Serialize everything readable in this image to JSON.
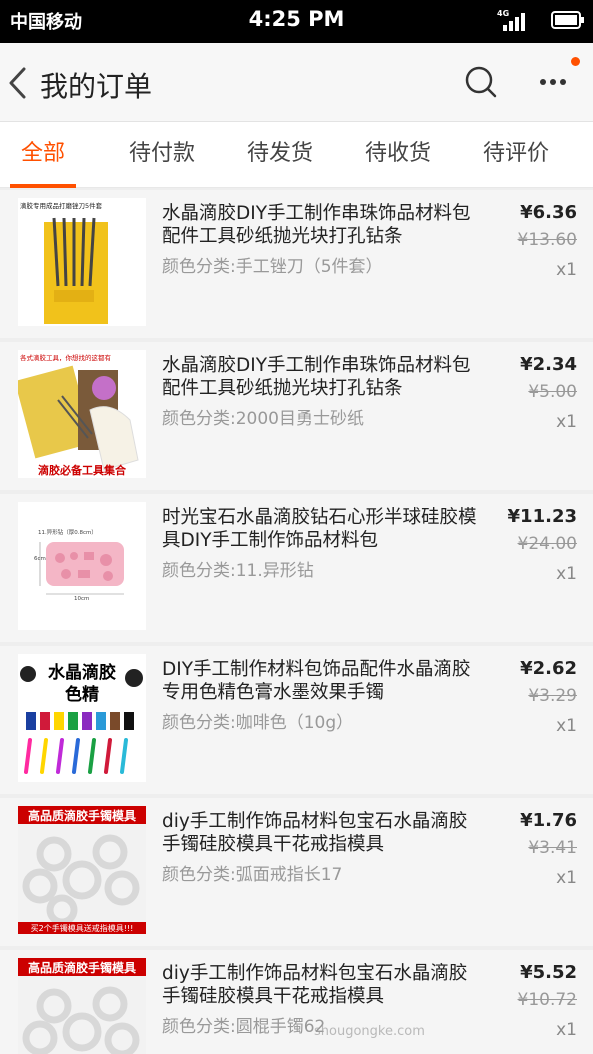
{
  "status_bar": {
    "carrier": "中国移动",
    "time": "4:25 PM",
    "network": "4G"
  },
  "nav": {
    "title": "我的订单",
    "icons": [
      "back-chevron-icon",
      "search-icon",
      "more-icon"
    ]
  },
  "tabs": [
    {
      "label": "全部",
      "active": true
    },
    {
      "label": "待付款",
      "active": false
    },
    {
      "label": "待发货",
      "active": false
    },
    {
      "label": "待收货",
      "active": false
    },
    {
      "label": "待评价",
      "active": false
    }
  ],
  "orders": [
    {
      "title": "水晶滴胶DIY手工制作串珠饰品材料包配件工具砂纸抛光块打孔钻条",
      "spec": "颜色分类:手工锉刀（5件套）",
      "price": "¥6.36",
      "original_price": "¥13.60",
      "qty": "x1",
      "thumb_caption": "滴胶专用成品打磨锉刀5件套"
    },
    {
      "title": "水晶滴胶DIY手工制作串珠饰品材料包配件工具砂纸抛光块打孔钻条",
      "spec": "颜色分类:2000目勇士砂纸",
      "price": "¥2.34",
      "original_price": "¥5.00",
      "qty": "x1",
      "thumb_caption": "各式滴胶工具，你想找的这都有",
      "thumb_caption_bottom": "滴胶必备工具集合"
    },
    {
      "title": "时光宝石水晶滴胶钻石心形半球硅胶模具DIY手工制作饰品材料包",
      "spec": "颜色分类:11.异形钻",
      "price": "¥11.23",
      "original_price": "¥24.00",
      "qty": "x1",
      "thumb_caption": "11.异形钻（厚0.8cm）",
      "thumb_dim_side": "6cm",
      "thumb_dim_bottom": "10cm"
    },
    {
      "title": "DIY手工制作材料包饰品配件水晶滴胶专用色精色膏水墨效果手镯",
      "spec": "颜色分类:咖啡色（10g）",
      "price": "¥2.62",
      "original_price": "¥3.29",
      "qty": "x1",
      "thumb_caption": "水晶滴胶",
      "thumb_caption_bottom": "色精"
    },
    {
      "title": "diy手工制作饰品材料包宝石水晶滴胶手镯硅胶模具干花戒指模具",
      "spec": "颜色分类:弧面戒指长17",
      "price": "¥1.76",
      "original_price": "¥3.41",
      "qty": "x1",
      "thumb_caption": "高品质滴胶手镯模具",
      "thumb_caption_bottom": "买2个手镯模具送戒指模具!!!"
    },
    {
      "title": "diy手工制作饰品材料包宝石水晶滴胶手镯硅胶模具干花戒指模具",
      "spec": "颜色分类:圆棍手镯62",
      "price": "¥5.52",
      "original_price": "¥10.72",
      "qty": "x1",
      "thumb_caption": "高品质滴胶手镯模具"
    }
  ],
  "watermark": "shougongke.com",
  "colors": {
    "accent": "#ff5000",
    "muted": "#999999"
  }
}
